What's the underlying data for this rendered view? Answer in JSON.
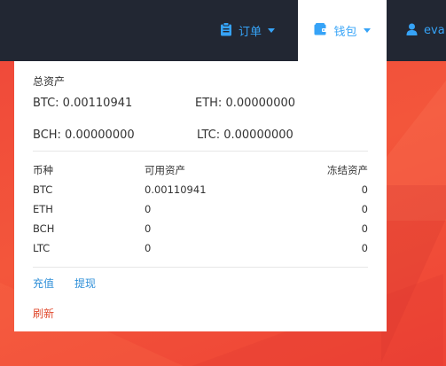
{
  "nav": {
    "orders_label": "订单",
    "wallet_label": "钱包",
    "user_label": "eva"
  },
  "wallet": {
    "total_assets_title": "总资产",
    "balances": [
      {
        "text": "BTC: 0.00110941"
      },
      {
        "text": "ETH: 0.00000000"
      },
      {
        "text": "BCH: 0.00000000"
      },
      {
        "text": "LTC: 0.00000000"
      }
    ],
    "table": {
      "headers": [
        "币种",
        "可用资产",
        "冻结资产"
      ],
      "rows": [
        [
          "BTC",
          "0.00110941",
          "0"
        ],
        [
          "ETH",
          "0",
          "0"
        ],
        [
          "BCH",
          "0",
          "0"
        ],
        [
          "LTC",
          "0",
          "0"
        ]
      ]
    },
    "deposit_label": "充值",
    "withdraw_label": "提现",
    "refresh_label": "刷新"
  },
  "colors": {
    "navbar_bg": "#222733",
    "accent": "#36a3f7",
    "background": "#f3533b",
    "refresh": "#e04b2f"
  },
  "icons": {
    "orders": "clipboard-icon",
    "wallet": "wallet-icon",
    "user": "user-icon",
    "dropdown": "caret-down-icon"
  }
}
